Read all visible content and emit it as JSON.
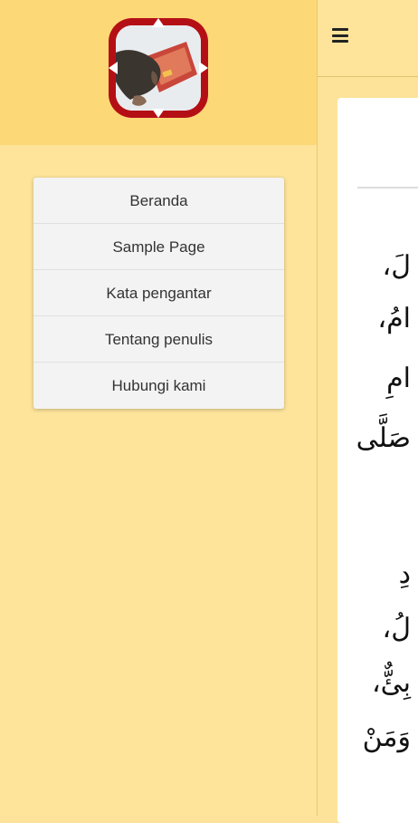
{
  "drawer": {
    "menu_items": [
      {
        "label": "Beranda"
      },
      {
        "label": "Sample Page"
      },
      {
        "label": "Kata pengantar"
      },
      {
        "label": "Tentang penulis"
      },
      {
        "label": "Hubungi kami"
      }
    ]
  },
  "main": {
    "arabic_lines": [
      "لَ،",
      "امُ،",
      "امِ",
      "صَلَّى",
      "دِ",
      "لُ،",
      "بِئٌّ،",
      "وَمَنْ"
    ]
  },
  "colors": {
    "header_bg": "#fdd877",
    "drawer_bg": "#fde49a",
    "logo_border": "#b50f16"
  },
  "icons": [
    "app-logo",
    "hamburger-menu-icon"
  ]
}
